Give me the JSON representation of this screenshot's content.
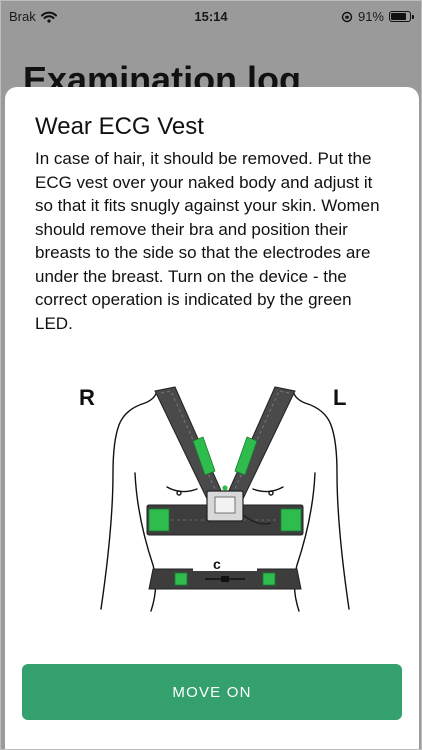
{
  "status_bar": {
    "carrier": "Brak",
    "time": "15:14",
    "battery": "91%",
    "battery_level": 0.91
  },
  "background_title": "Examination log",
  "sheet": {
    "title": "Wear ECG Vest",
    "text": "In case of hair, it should be removed. Put the ECG vest over your naked body and adjust it so that it fits snugly against your skin. Women should remove their bra and position their breasts to the side so that the electrodes are under the breast. Turn on the device - the correct operation is indicated by the green LED.",
    "illustration": {
      "right_label": "R",
      "left_label": "L",
      "belt_label": "c"
    },
    "button_label": "MOVE ON"
  },
  "colors": {
    "accent": "#33a06e",
    "electrode": "#2ebd4c",
    "vest": "#4a4a4a"
  }
}
